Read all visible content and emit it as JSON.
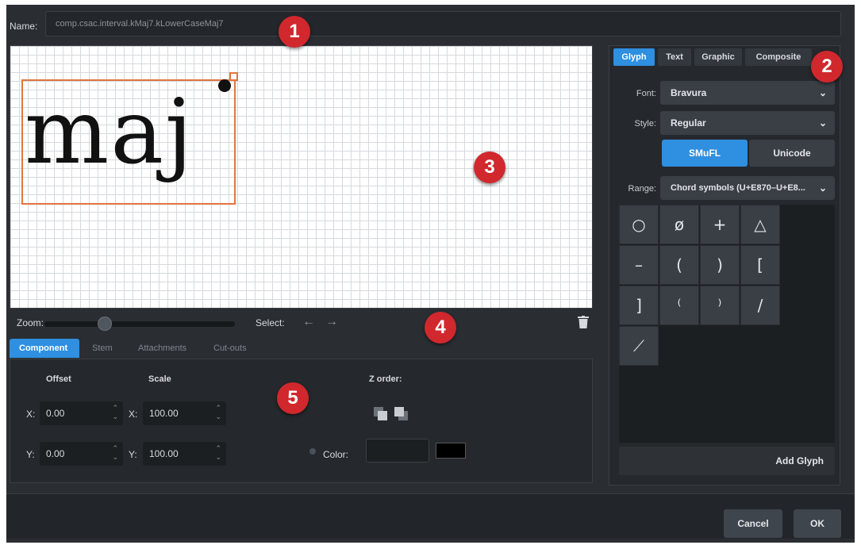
{
  "name_row": {
    "label": "Name:",
    "value": "comp.csac.interval.kMaj7.kLowerCaseMaj7"
  },
  "canvas": {
    "glyph_text": "maj"
  },
  "badges": [
    "1",
    "2",
    "3",
    "4",
    "5"
  ],
  "zoom": {
    "label": "Zoom:",
    "level_fraction": 0.3
  },
  "select": {
    "label": "Select:",
    "prev_arrow": "←",
    "next_arrow": "→"
  },
  "component_tabs": [
    "Component",
    "Stem",
    "Attachments",
    "Cut-outs"
  ],
  "component": {
    "offset_label": "Offset",
    "scale_label": "Scale",
    "z_order_label": "Z order:",
    "axis_x": "X:",
    "axis_y": "Y:",
    "offset_x": "0.00",
    "offset_y": "0.00",
    "scale_x": "100.00",
    "scale_y": "100.00",
    "color_label": "Color:",
    "color_value": "#000000"
  },
  "right_tabs": [
    "Glyph",
    "Text",
    "Graphic",
    "Composite"
  ],
  "glyph_panel": {
    "font_label": "Font:",
    "font_value": "Bravura",
    "style_label": "Style:",
    "style_value": "Regular",
    "mode_smufl": "SMuFL",
    "mode_unicode": "Unicode",
    "range_label": "Range:",
    "range_value": "Chord symbols (U+E870–U+E8...",
    "glyphs": [
      "○",
      "ø",
      "+",
      "△",
      "–",
      "(",
      ")",
      "[",
      "]",
      "⁽",
      "⁾",
      "/",
      "⟋"
    ],
    "add_glyph": "Add Glyph"
  },
  "footer": {
    "cancel": "Cancel",
    "ok": "OK"
  },
  "colors": {
    "accent": "#2f8fe0",
    "badge": "#d0282d",
    "selection": "#e0763d",
    "panel": "#2a2e33"
  }
}
